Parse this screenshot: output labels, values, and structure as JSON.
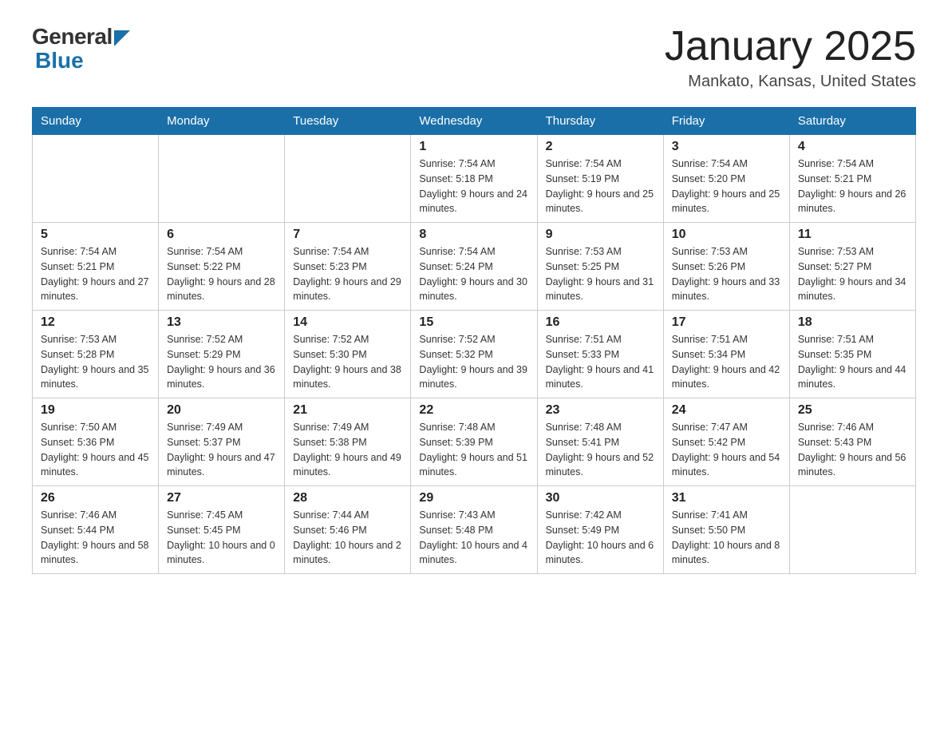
{
  "header": {
    "logo_general": "General",
    "logo_blue": "Blue",
    "title": "January 2025",
    "location": "Mankato, Kansas, United States"
  },
  "weekdays": [
    "Sunday",
    "Monday",
    "Tuesday",
    "Wednesday",
    "Thursday",
    "Friday",
    "Saturday"
  ],
  "weeks": [
    [
      null,
      null,
      null,
      {
        "day": 1,
        "sunrise": "7:54 AM",
        "sunset": "5:18 PM",
        "daylight": "9 hours and 24 minutes."
      },
      {
        "day": 2,
        "sunrise": "7:54 AM",
        "sunset": "5:19 PM",
        "daylight": "9 hours and 25 minutes."
      },
      {
        "day": 3,
        "sunrise": "7:54 AM",
        "sunset": "5:20 PM",
        "daylight": "9 hours and 25 minutes."
      },
      {
        "day": 4,
        "sunrise": "7:54 AM",
        "sunset": "5:21 PM",
        "daylight": "9 hours and 26 minutes."
      }
    ],
    [
      {
        "day": 5,
        "sunrise": "7:54 AM",
        "sunset": "5:21 PM",
        "daylight": "9 hours and 27 minutes."
      },
      {
        "day": 6,
        "sunrise": "7:54 AM",
        "sunset": "5:22 PM",
        "daylight": "9 hours and 28 minutes."
      },
      {
        "day": 7,
        "sunrise": "7:54 AM",
        "sunset": "5:23 PM",
        "daylight": "9 hours and 29 minutes."
      },
      {
        "day": 8,
        "sunrise": "7:54 AM",
        "sunset": "5:24 PM",
        "daylight": "9 hours and 30 minutes."
      },
      {
        "day": 9,
        "sunrise": "7:53 AM",
        "sunset": "5:25 PM",
        "daylight": "9 hours and 31 minutes."
      },
      {
        "day": 10,
        "sunrise": "7:53 AM",
        "sunset": "5:26 PM",
        "daylight": "9 hours and 33 minutes."
      },
      {
        "day": 11,
        "sunrise": "7:53 AM",
        "sunset": "5:27 PM",
        "daylight": "9 hours and 34 minutes."
      }
    ],
    [
      {
        "day": 12,
        "sunrise": "7:53 AM",
        "sunset": "5:28 PM",
        "daylight": "9 hours and 35 minutes."
      },
      {
        "day": 13,
        "sunrise": "7:52 AM",
        "sunset": "5:29 PM",
        "daylight": "9 hours and 36 minutes."
      },
      {
        "day": 14,
        "sunrise": "7:52 AM",
        "sunset": "5:30 PM",
        "daylight": "9 hours and 38 minutes."
      },
      {
        "day": 15,
        "sunrise": "7:52 AM",
        "sunset": "5:32 PM",
        "daylight": "9 hours and 39 minutes."
      },
      {
        "day": 16,
        "sunrise": "7:51 AM",
        "sunset": "5:33 PM",
        "daylight": "9 hours and 41 minutes."
      },
      {
        "day": 17,
        "sunrise": "7:51 AM",
        "sunset": "5:34 PM",
        "daylight": "9 hours and 42 minutes."
      },
      {
        "day": 18,
        "sunrise": "7:51 AM",
        "sunset": "5:35 PM",
        "daylight": "9 hours and 44 minutes."
      }
    ],
    [
      {
        "day": 19,
        "sunrise": "7:50 AM",
        "sunset": "5:36 PM",
        "daylight": "9 hours and 45 minutes."
      },
      {
        "day": 20,
        "sunrise": "7:49 AM",
        "sunset": "5:37 PM",
        "daylight": "9 hours and 47 minutes."
      },
      {
        "day": 21,
        "sunrise": "7:49 AM",
        "sunset": "5:38 PM",
        "daylight": "9 hours and 49 minutes."
      },
      {
        "day": 22,
        "sunrise": "7:48 AM",
        "sunset": "5:39 PM",
        "daylight": "9 hours and 51 minutes."
      },
      {
        "day": 23,
        "sunrise": "7:48 AM",
        "sunset": "5:41 PM",
        "daylight": "9 hours and 52 minutes."
      },
      {
        "day": 24,
        "sunrise": "7:47 AM",
        "sunset": "5:42 PM",
        "daylight": "9 hours and 54 minutes."
      },
      {
        "day": 25,
        "sunrise": "7:46 AM",
        "sunset": "5:43 PM",
        "daylight": "9 hours and 56 minutes."
      }
    ],
    [
      {
        "day": 26,
        "sunrise": "7:46 AM",
        "sunset": "5:44 PM",
        "daylight": "9 hours and 58 minutes."
      },
      {
        "day": 27,
        "sunrise": "7:45 AM",
        "sunset": "5:45 PM",
        "daylight": "10 hours and 0 minutes."
      },
      {
        "day": 28,
        "sunrise": "7:44 AM",
        "sunset": "5:46 PM",
        "daylight": "10 hours and 2 minutes."
      },
      {
        "day": 29,
        "sunrise": "7:43 AM",
        "sunset": "5:48 PM",
        "daylight": "10 hours and 4 minutes."
      },
      {
        "day": 30,
        "sunrise": "7:42 AM",
        "sunset": "5:49 PM",
        "daylight": "10 hours and 6 minutes."
      },
      {
        "day": 31,
        "sunrise": "7:41 AM",
        "sunset": "5:50 PM",
        "daylight": "10 hours and 8 minutes."
      },
      null
    ]
  ],
  "labels": {
    "sunrise_prefix": "Sunrise: ",
    "sunset_prefix": "Sunset: ",
    "daylight_prefix": "Daylight: "
  }
}
